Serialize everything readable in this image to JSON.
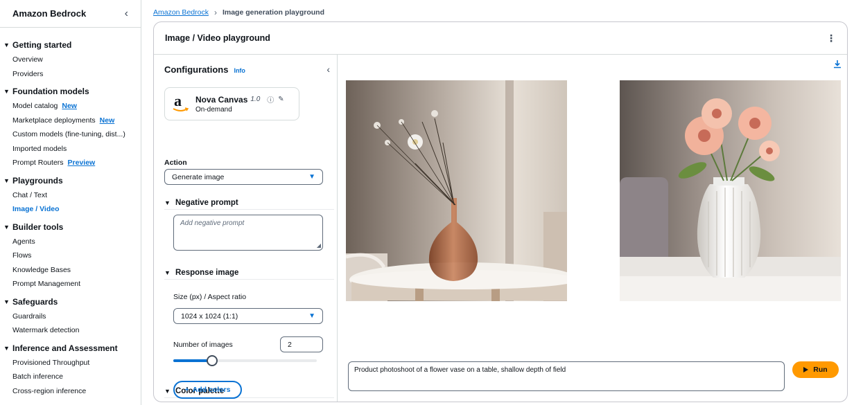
{
  "sidebar": {
    "title": "Amazon Bedrock",
    "sections": [
      {
        "title": "Getting started",
        "items": [
          {
            "label": "Overview"
          },
          {
            "label": "Providers"
          }
        ]
      },
      {
        "title": "Foundation models",
        "items": [
          {
            "label": "Model catalog",
            "badge": "New"
          },
          {
            "label": "Marketplace deployments",
            "badge": "New"
          },
          {
            "label": "Custom models (fine-tuning, dist...)"
          },
          {
            "label": "Imported models"
          },
          {
            "label": "Prompt Routers",
            "badge": "Preview"
          }
        ]
      },
      {
        "title": "Playgrounds",
        "items": [
          {
            "label": "Chat / Text"
          },
          {
            "label": "Image / Video",
            "active": true
          }
        ]
      },
      {
        "title": "Builder tools",
        "items": [
          {
            "label": "Agents"
          },
          {
            "label": "Flows"
          },
          {
            "label": "Knowledge Bases"
          },
          {
            "label": "Prompt Management"
          }
        ]
      },
      {
        "title": "Safeguards",
        "items": [
          {
            "label": "Guardrails"
          },
          {
            "label": "Watermark detection"
          }
        ]
      },
      {
        "title": "Inference and Assessment",
        "items": [
          {
            "label": "Provisioned Throughput"
          },
          {
            "label": "Batch inference"
          },
          {
            "label": "Cross-region inference"
          }
        ]
      }
    ]
  },
  "breadcrumb": {
    "root": "Amazon Bedrock",
    "current": "Image generation playground"
  },
  "panel": {
    "title": "Image / Video playground"
  },
  "config": {
    "title": "Configurations",
    "info": "Info",
    "model": {
      "name": "Nova Canvas",
      "version": "1.0",
      "mode": "On-demand"
    },
    "action_label": "Action",
    "action_value": "Generate image",
    "negative_prompt_title": "Negative prompt",
    "negative_prompt_placeholder": "Add negative prompt",
    "response_image_title": "Response image",
    "size_label": "Size (px) / Aspect ratio",
    "size_value": "1024 x 1024 (1:1)",
    "num_images_label": "Number of images",
    "num_images_value": "2",
    "num_images_fraction": 0.27,
    "color_palette_title": "Color palette",
    "add_colors_label": "Add colors"
  },
  "output": {
    "prompt": "Product photoshoot of a flower vase on a table, shallow depth of field",
    "run_label": "Run"
  },
  "colors": {
    "link": "#0972d3",
    "run": "#ff9900",
    "border": "#d5dbdb"
  }
}
